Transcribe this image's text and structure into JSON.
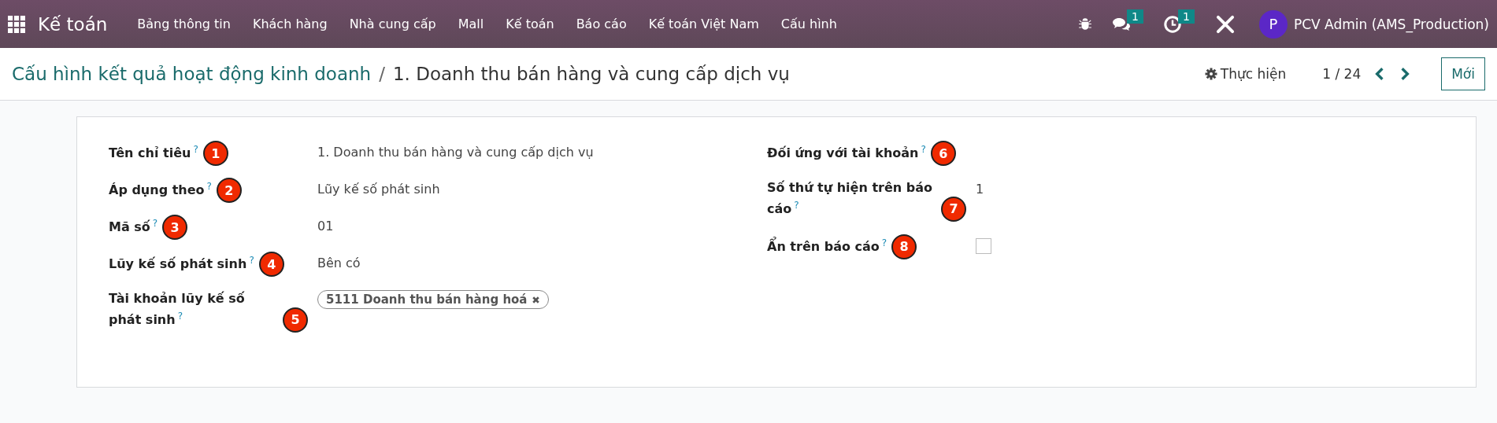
{
  "navbar": {
    "app_name": "Kế toán",
    "menu": [
      "Bảng thông tin",
      "Khách hàng",
      "Nhà cung cấp",
      "Mall",
      "Kế toán",
      "Báo cáo",
      "Kế toán Việt Nam",
      "Cấu hình"
    ],
    "messages_count": "1",
    "activities_count": "1",
    "user": {
      "initial": "P",
      "name": "PCV Admin (AMS_Production)"
    }
  },
  "control": {
    "breadcrumb_parent": "Cấu hình kết quả hoạt động kinh doanh",
    "separator": "/",
    "breadcrumb_current": "1. Doanh thu bán hàng và cung cấp dịch vụ",
    "action": "Thực hiện",
    "pager": "1 / 24",
    "new_button": "Mới"
  },
  "form": {
    "left_fields": [
      {
        "label": "Tên chỉ tiêu",
        "help": "?",
        "marker": "1",
        "kind": "text",
        "value": "1. Doanh thu bán hàng và cung cấp dịch vụ"
      },
      {
        "label": "Áp dụng theo",
        "help": "?",
        "marker": "2",
        "kind": "text",
        "value": "Lũy kế số phát sinh"
      },
      {
        "label": "Mã số",
        "help": "?",
        "marker": "3",
        "kind": "text",
        "value": "01"
      },
      {
        "label": "Lũy kế số phát sinh",
        "help": "?",
        "marker": "4",
        "kind": "text",
        "value": "Bên có"
      },
      {
        "label": "Tài khoản lũy kế số phát sinh",
        "help": "?",
        "marker": "5",
        "kind": "tags",
        "tags": [
          "5111 Doanh thu bán hàng hoá"
        ]
      }
    ],
    "right_fields": [
      {
        "label": "Đối ứng với tài khoản",
        "help": "?",
        "marker": "6",
        "kind": "empty"
      },
      {
        "label": "Số thứ tự hiện trên báo cáo",
        "help": "?",
        "marker": "7",
        "kind": "text",
        "value": "1"
      },
      {
        "label": "Ẩn trên báo cáo",
        "help": "?",
        "marker": "8",
        "kind": "checkbox",
        "checked": false
      }
    ]
  }
}
